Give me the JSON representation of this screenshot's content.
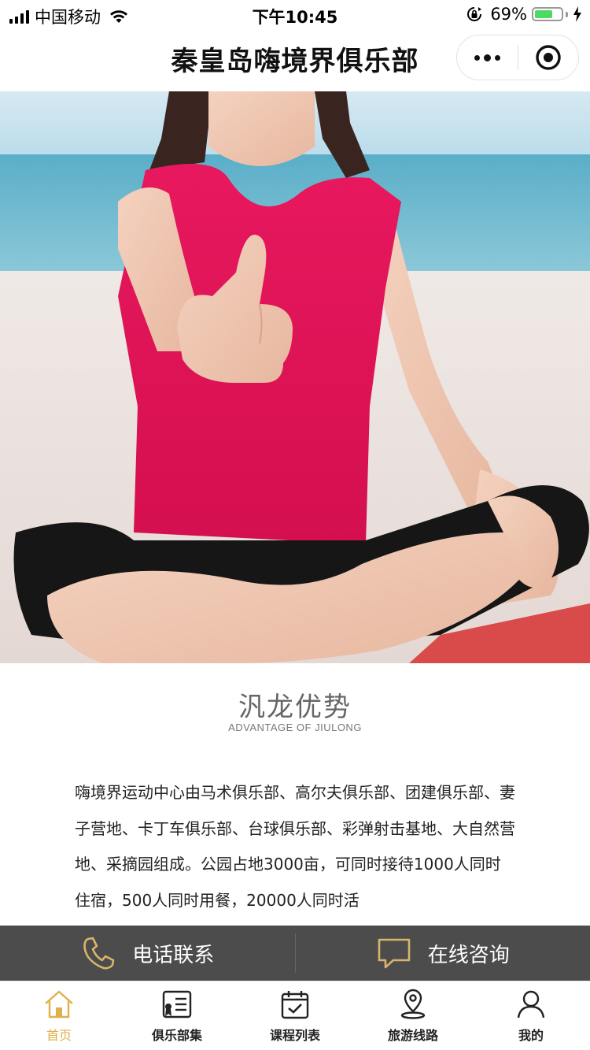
{
  "status_bar": {
    "carrier": "中国移动",
    "time": "下午10:45",
    "battery_percent": "69%",
    "battery_level": 0.69,
    "icons": [
      "signal-icon",
      "wifi-icon",
      "rotation-lock-icon",
      "battery-icon",
      "charging-bolt-icon"
    ]
  },
  "header": {
    "title": "秦皇岛嗨境界俱乐部",
    "capsule_icons": [
      "more-dots-icon",
      "close-target-icon"
    ]
  },
  "hero": {
    "image_desc_icon": "hero-photo"
  },
  "section": {
    "title": "汎龙优势",
    "subtitle": "ADVANTAGE OF JIULONG"
  },
  "intro": {
    "text": "嗨境界运动中心由马术俱乐部、高尔夫俱乐部、团建俱乐部、妻子营地、卡丁车俱乐部、台球俱乐部、彩弹射击基地、大自然营地、采摘园组成。公园占地3000亩，可同时接待1000人同时住宿，500人同时用餐，20000人同时活"
  },
  "contact": {
    "phone_label": "电话联系",
    "chat_label": "在线咨询",
    "icon_color": "#d8b56a"
  },
  "tabs": [
    {
      "label": "首页",
      "icon": "home-icon",
      "active": true
    },
    {
      "label": "俱乐部集",
      "icon": "club-list-icon",
      "active": false
    },
    {
      "label": "课程列表",
      "icon": "calendar-check-icon",
      "active": false
    },
    {
      "label": "旅游线路",
      "icon": "location-pin-icon",
      "active": false
    },
    {
      "label": "我的",
      "icon": "user-icon",
      "active": false
    }
  ],
  "colors": {
    "accent": "#e0b04a",
    "contact_bar": "#4c4c4c",
    "battery": "#4cd964"
  }
}
